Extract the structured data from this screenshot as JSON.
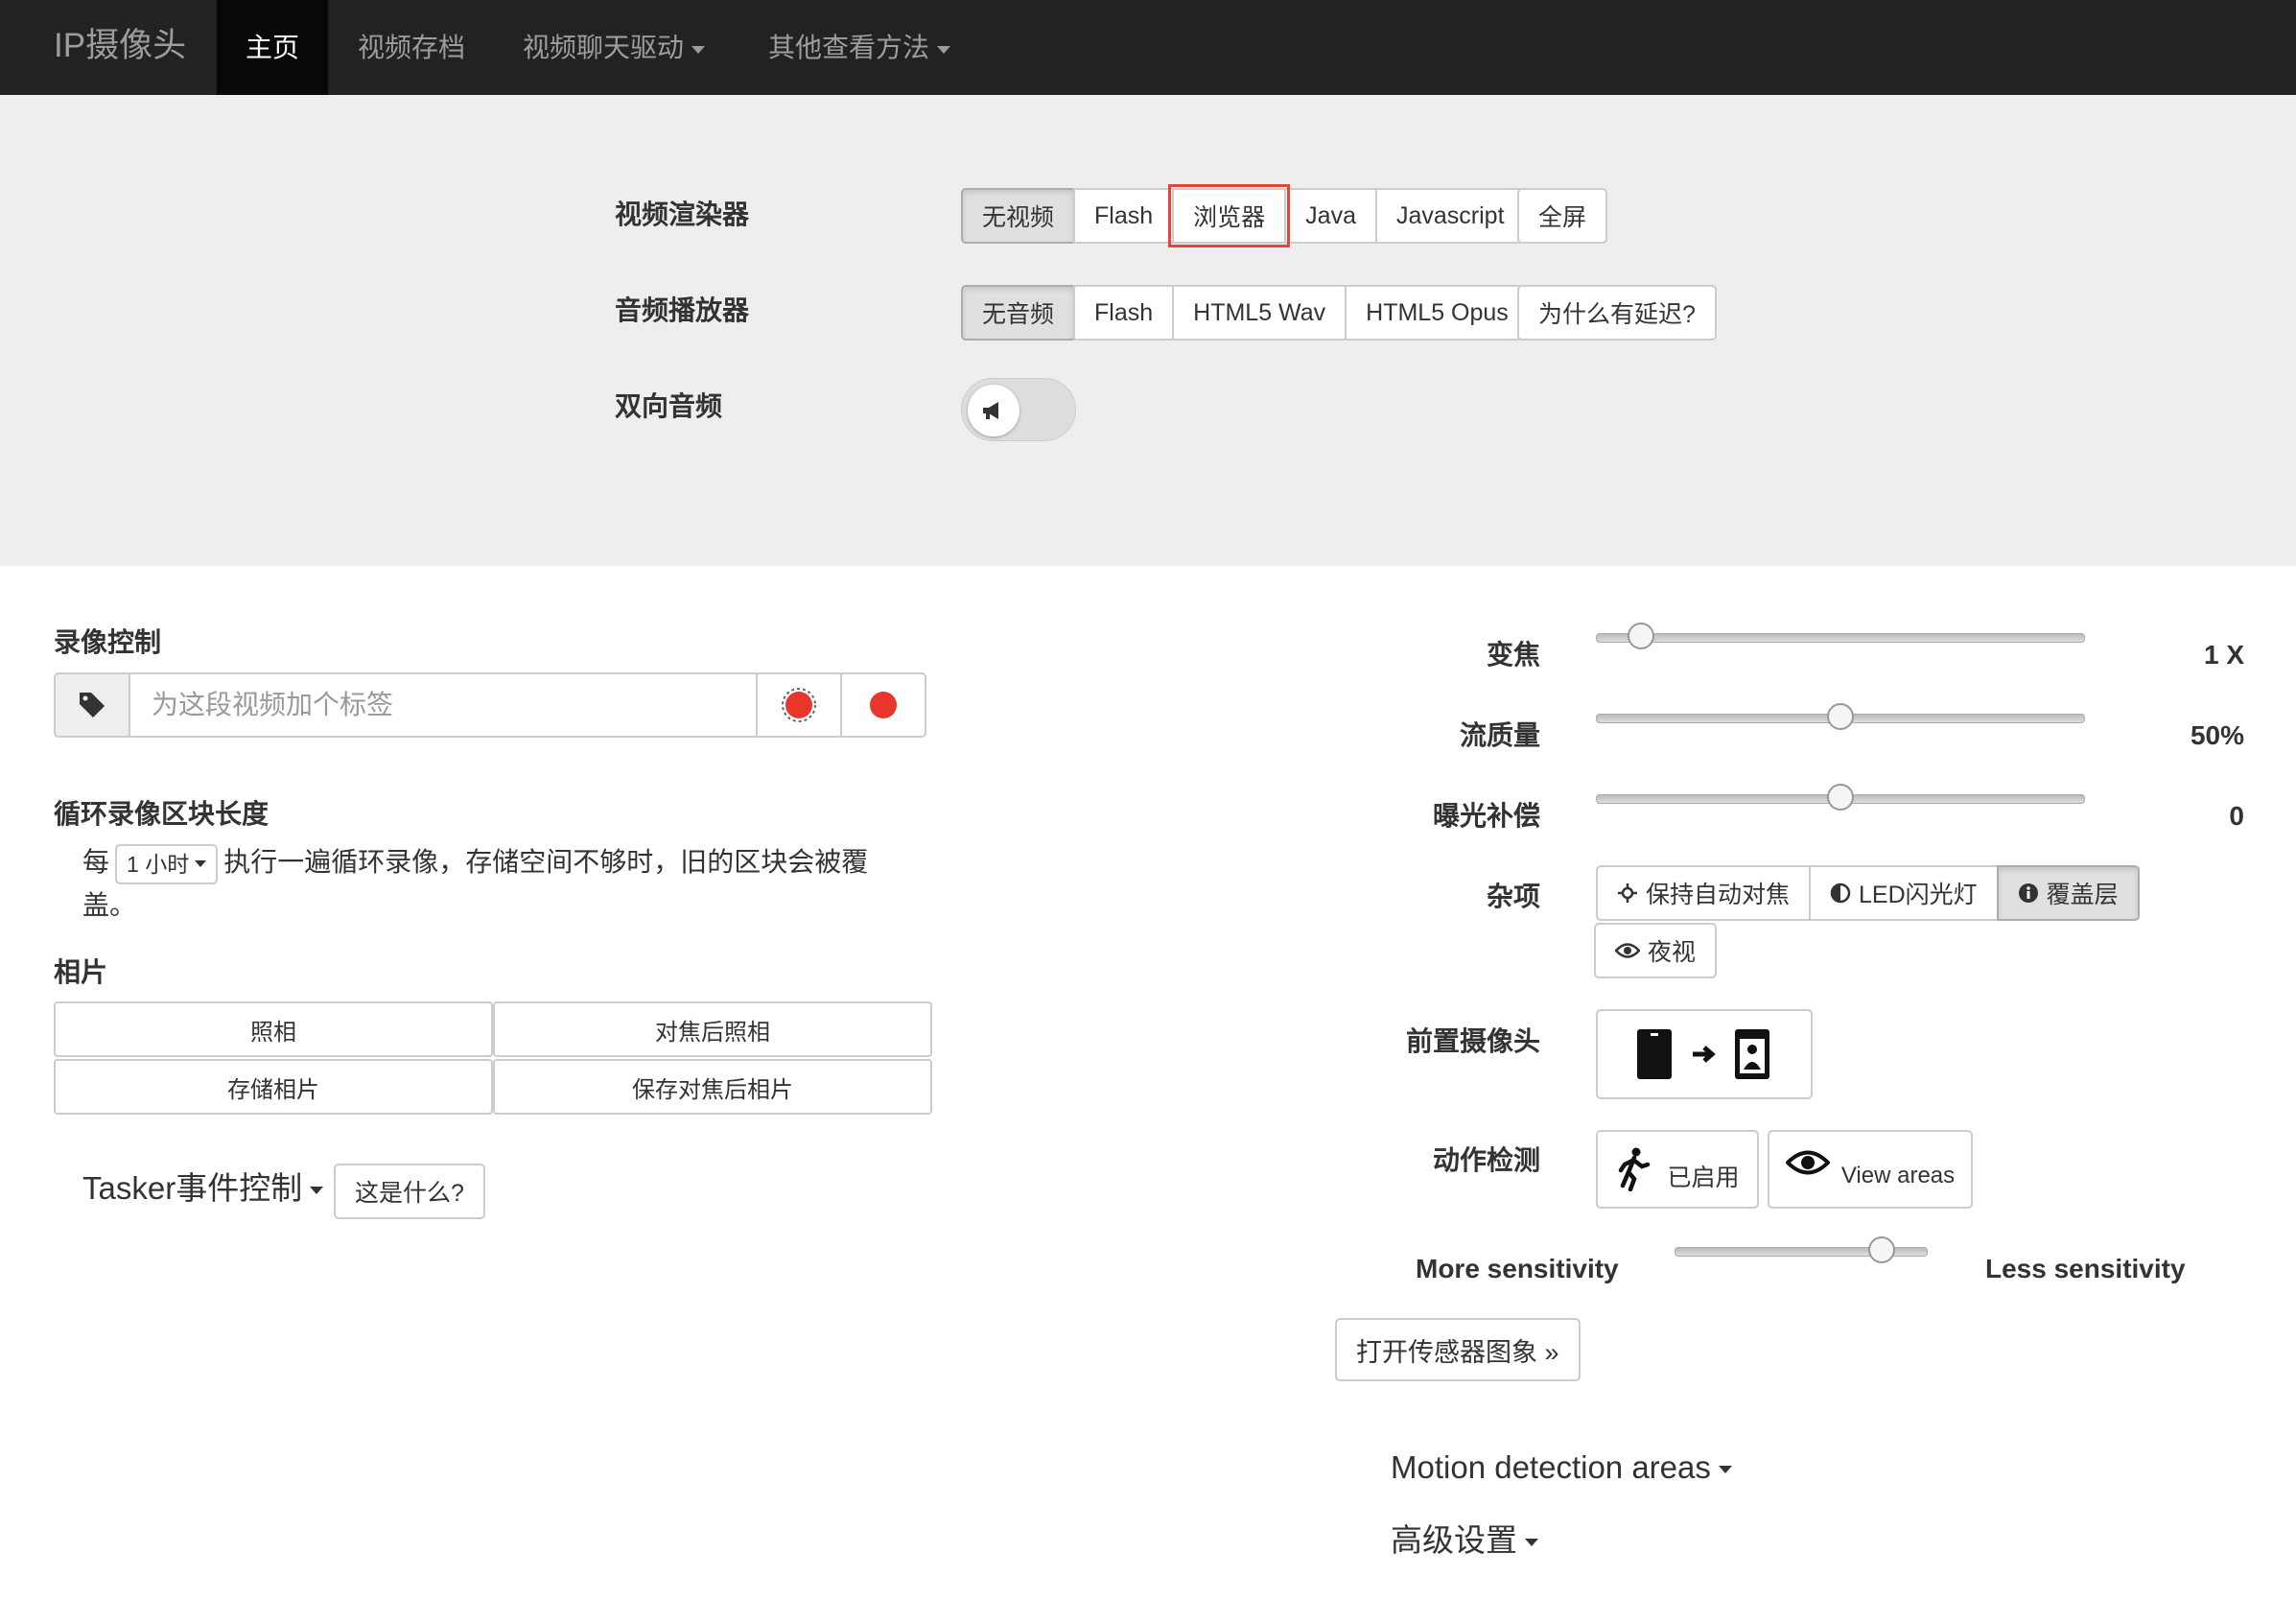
{
  "navbar": {
    "brand": "IP摄像头",
    "items": [
      {
        "label": "主页",
        "active": true
      },
      {
        "label": "视频存档",
        "active": false
      },
      {
        "label": "视频聊天驱动",
        "dropdown": true
      },
      {
        "label": "其他查看方法",
        "dropdown": true
      }
    ]
  },
  "settings": {
    "video_renderer": {
      "label": "视频渲染器",
      "options": [
        "无视频",
        "Flash",
        "浏览器",
        "Java",
        "Javascript"
      ],
      "selected": "无视频",
      "highlighted": "浏览器",
      "fullscreen": "全屏"
    },
    "audio_player": {
      "label": "音频播放器",
      "options": [
        "无音频",
        "Flash",
        "HTML5 Wav",
        "HTML5 Opus"
      ],
      "selected": "无音频",
      "why_delay": "为什么有延迟?"
    },
    "two_way_audio": {
      "label": "双向音频",
      "enabled": false
    }
  },
  "recording": {
    "title": "录像控制",
    "tag_placeholder": "为这段视频加个标签",
    "record_color": "#e8362a"
  },
  "loop": {
    "title": "循环录像区块长度",
    "prefix": "每",
    "interval": "1 小时",
    "suffix_line1": "执行一遍循环录像，存储空间不够时，旧的区块会被覆",
    "suffix_line2": "盖。"
  },
  "photos": {
    "title": "相片",
    "buttons": [
      "照相",
      "对焦后照相",
      "存储相片",
      "保存对焦后相片"
    ]
  },
  "tasker": {
    "label": "Tasker事件控制",
    "help": "这是什么?"
  },
  "controls": {
    "zoom": {
      "label": "变焦",
      "value_text": "1 X",
      "fraction": 0.09
    },
    "quality": {
      "label": "流质量",
      "value_text": "50%",
      "fraction": 0.5
    },
    "exposure": {
      "label": "曝光补偿",
      "value_text": "0",
      "fraction": 0.5
    },
    "misc": {
      "label": "杂项",
      "buttons": [
        {
          "label": "保持自动对焦",
          "icon": "crosshair-icon",
          "active": false
        },
        {
          "label": "LED闪光灯",
          "icon": "half-circle-icon",
          "active": false
        },
        {
          "label": "覆盖层",
          "icon": "info-icon",
          "active": true
        },
        {
          "label": "夜视",
          "icon": "eye-icon",
          "active": false
        }
      ]
    },
    "front_camera": {
      "label": "前置摄像头"
    },
    "motion": {
      "label": "动作检测",
      "enabled_label": "已启用",
      "view_areas": "View areas"
    },
    "sensitivity": {
      "more": "More sensitivity",
      "less": "Less sensitivity",
      "fraction": 0.82
    },
    "sensor_graph": "打开传感器图象 »",
    "motion_areas": "Motion detection areas",
    "advanced": "高级设置"
  }
}
